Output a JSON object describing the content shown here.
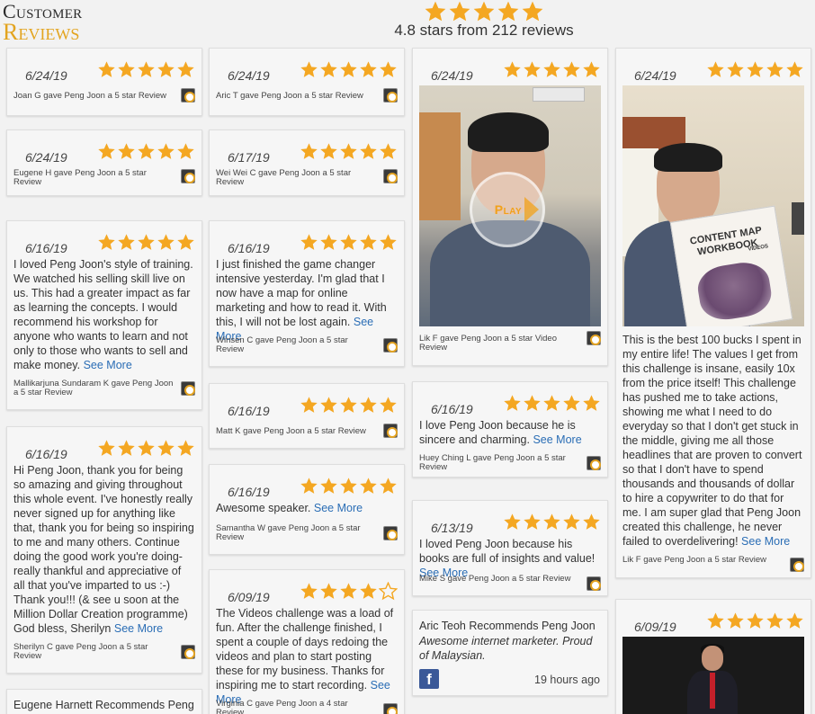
{
  "brand": {
    "line1": "Customer",
    "line2": "Reviews"
  },
  "summary": {
    "rating_text": "4.8 stars from 212 reviews",
    "stars": 5
  },
  "colors": {
    "star": "#f4a722",
    "link": "#2a6db5",
    "brand_gold": "#e3a41f",
    "facebook": "#3b5998"
  },
  "icons": {
    "badge": "review-source-badge-icon",
    "star": "star-icon",
    "play": "play-button-icon",
    "facebook": "facebook-icon"
  },
  "reviews": {
    "c1_1": {
      "date": "6/24/19",
      "rating": 5,
      "gave": "Joan G gave Peng Joon a 5 star Review"
    },
    "c1_2": {
      "date": "6/24/19",
      "rating": 5,
      "gave": "Eugene H gave Peng Joon a 5 star Review"
    },
    "c1_3": {
      "date": "6/16/19",
      "rating": 5,
      "text": "I loved Peng Joon's style of training. We watched his selling skill live on us. This had a greater impact as far as learning the concepts. I would recommend his workshop for anyone who wants to learn and not only to those who wants to sell and make money.",
      "more": "See More",
      "gave": "Mallikarjuna Sundaram K gave Peng Joon a 5 star Review"
    },
    "c1_4": {
      "date": "6/16/19",
      "rating": 5,
      "text": "Hi Peng Joon, thank you for being so amazing and giving throughout this whole event. I've honestly really never signed up for anything like that, thank you for being so inspiring to me and many others. Continue doing the good work you're doing- really thankful and appreciative of all that you've imparted to us :-) Thank you!!! (& see u soon at the Million Dollar Creation programme) God bless, Sherilyn",
      "more": "See More",
      "gave": "Sherilyn C gave Peng Joon a 5 star Review"
    },
    "c1_5": {
      "title": "Eugene Harnett Recommends Peng"
    },
    "c2_1": {
      "date": "6/24/19",
      "rating": 5,
      "gave": "Aric T gave Peng Joon a 5 star Review"
    },
    "c2_2": {
      "date": "6/17/19",
      "rating": 5,
      "gave": "Wei Wei C gave Peng Joon a 5 star Review"
    },
    "c2_3": {
      "date": "6/16/19",
      "rating": 5,
      "text": "I just finished the game changer intensive yesterday. I'm glad that I now have a map for online marketing and how to read it. With this, I will not be lost again.",
      "more": "See More",
      "gave": "Winsen C gave Peng Joon a 5 star Review"
    },
    "c2_4": {
      "date": "6/16/19",
      "rating": 5,
      "gave": "Matt K gave Peng Joon a 5 star Review"
    },
    "c2_5": {
      "date": "6/16/19",
      "rating": 5,
      "text": "Awesome speaker.",
      "more": "See More",
      "gave": "Samantha W gave Peng Joon a 5 star Review"
    },
    "c2_6": {
      "date": "6/09/19",
      "rating": 4,
      "text": "The Videos challenge was a load of fun. After the challenge finished, I spent a couple of days redoing the videos and plan to start posting these for my business. Thanks for inspiring me to start recording.",
      "more": "See More",
      "gave": "Virginia C gave Peng Joon a 4 star Review"
    },
    "c3_1": {
      "date": "6/24/19",
      "rating": 5,
      "play_label": "Play",
      "gave": "Lik F gave Peng Joon a 5 star Video Review"
    },
    "c3_2": {
      "date": "6/16/19",
      "rating": 5,
      "text": "I love Peng Joon because he is sincere and charming.",
      "more": "See More",
      "gave": "Huey Ching L gave Peng Joon a 5 star Review"
    },
    "c3_3": {
      "date": "6/13/19",
      "rating": 5,
      "text": "I loved Peng Joon because his books are full of insights and value!",
      "more": "See More",
      "gave": "Mike S gave Peng Joon a 5 star Review"
    },
    "c3_4": {
      "title": "Aric Teoh Recommends Peng Joon",
      "quote": "Awesome internet marketer. Proud of Malaysian.",
      "time": "19 hours ago"
    },
    "c4_1": {
      "date": "6/24/19",
      "rating": 5,
      "book_title": "CONTENT MAP WORKBOOK",
      "book_side": "VIDEOS",
      "text": "This is the best 100 bucks I spent in my entire life! The values I get from this challenge is insane, easily 10x from the price itself! This challenge has pushed me to take actions, showing me what I need to do everyday so that I don't get stuck in the middle, giving me all those headlines that are proven to convert so that I don't have to spend thousands and thousands of dollar to hire a copywriter to do that for me. I am super glad that Peng Joon created this challenge, he never failed to overdelivering!",
      "more": "See More",
      "gave": "Lik F gave Peng Joon a 5 star Review"
    },
    "c4_2": {
      "date": "6/09/19",
      "rating": 5
    }
  }
}
